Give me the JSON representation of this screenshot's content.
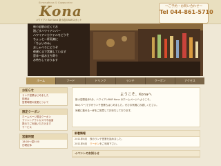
{
  "header": {
    "logo_sub": "Scrumptious & Cappuccino",
    "logo": "Kona",
    "logo_tag": "ハワイアン Bar Kona 新小岩のBARスポット",
    "contact_title": "〜ご予約・お問い合わせ〜",
    "contact_tel": "Tel 044-861-5710"
  },
  "hero": {
    "text_lines": [
      "新小岩駅の近くでお",
      "過ごすハワイアンバー",
      "",
      "ハワイアンカクテルをどうぞ",
      "ちょっと一杯気楽に",
      "「ちょいのみ」",
      "おしゃべりにどうぞ",
      "",
      "夜遅くまで営業しています",
      "是非一度お立ち寄り",
      "お待ちしております"
    ]
  },
  "nav": [
    {
      "label": "ホーム"
    },
    {
      "label": "フード"
    },
    {
      "label": "ドリンク"
    },
    {
      "label": "ランチ"
    },
    {
      "label": "クーポン"
    },
    {
      "label": "アクセス"
    }
  ],
  "sidebar": {
    "news": {
      "title": "お知らせ",
      "lines": [
        "ランチ営業はじめました",
        "詳細は",
        "営業時間の変更について"
      ]
    },
    "coupon": {
      "title": "限定クーポン",
      "lines": [
        "ホームページ限定クーポン",
        "プリントアウトかスマホ画面",
        "提示でご利用いただけます",
        "サービス"
      ]
    },
    "hours": {
      "title": "営業時間",
      "lines": [
        "18:00〜翌5:00",
        "日曜定休"
      ]
    }
  },
  "welcome": {
    "title": "ようこそ、Konaへ",
    "lines": [
      "新小岩駅徒歩3分、ハワイアンBAR Kona のホームページへようこそ。",
      "Bar(バー)ですがランチ営業もはじめました。ぜひお気軽にお越しください。",
      "気軽に飲める一杯をご用意してお待ちしております。"
    ]
  },
  "news_section": {
    "title": "新着情報",
    "items": [
      {
        "date": "2011年6月",
        "text": "夜のランチ営業を始めました。"
      },
      {
        "date": "2011年6月",
        "text": "クーポン",
        "extra": "をご利用下さい。"
      }
    ]
  },
  "event_section": {
    "title": "イベントのお知らせ"
  }
}
